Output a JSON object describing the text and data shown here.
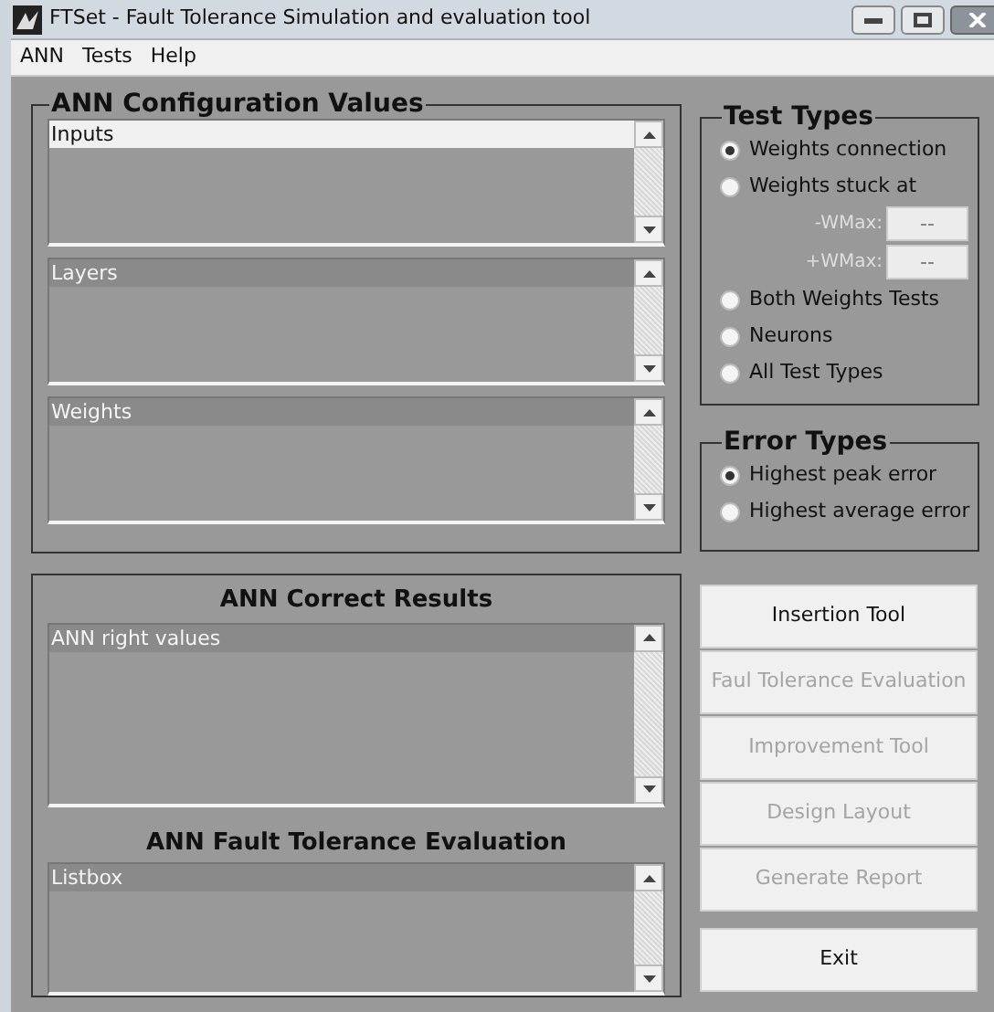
{
  "window": {
    "title": "FTSet - Fault Tolerance Simulation and evaluation tool"
  },
  "menu": [
    "ANN",
    "Tests",
    "Help"
  ],
  "config_panel": {
    "title": "ANN Configuration Values",
    "listboxes": [
      {
        "focused": true,
        "items": [
          {
            "label": "Inputs",
            "selected": true
          }
        ]
      },
      {
        "focused": false,
        "items": [
          {
            "label": "Layers",
            "selected": true
          }
        ]
      },
      {
        "focused": false,
        "items": [
          {
            "label": "Weights",
            "selected": true
          }
        ]
      }
    ]
  },
  "test_types": {
    "title": "Test Types",
    "options": [
      {
        "kind": "radio",
        "label": "Weights connection",
        "selected": true
      },
      {
        "kind": "radio",
        "label": "Weights stuck at",
        "selected": false,
        "fields": [
          {
            "label": "-WMax:",
            "value": "--",
            "disabled": true
          },
          {
            "label": "+WMax:",
            "value": "--",
            "disabled": true
          }
        ]
      },
      {
        "kind": "radio",
        "label": "Both Weights Tests",
        "selected": false
      },
      {
        "kind": "radio",
        "label": "Neurons",
        "selected": false
      },
      {
        "kind": "radio",
        "label": "All Test Types",
        "selected": false
      }
    ]
  },
  "error_types": {
    "title": "Error Types",
    "options": [
      {
        "label": "Highest peak error",
        "selected": true
      },
      {
        "label": "Highest average error",
        "selected": false
      }
    ]
  },
  "results_panel": [
    {
      "title": "ANN Correct Results",
      "listbox": {
        "focused": false,
        "items": [
          {
            "label": "ANN right values",
            "selected": true
          }
        ]
      }
    },
    {
      "title": "ANN Fault Tolerance Evaluation",
      "listbox": {
        "focused": false,
        "items": [
          {
            "label": "Listbox",
            "selected": true
          }
        ]
      }
    }
  ],
  "actions": [
    {
      "label": "Insertion Tool",
      "disabled": false
    },
    {
      "label": "Faul Tolerance Evaluation",
      "disabled": true
    },
    {
      "label": "Improvement Tool",
      "disabled": true
    },
    {
      "label": "Design Layout",
      "disabled": true
    },
    {
      "label": "Generate Report",
      "disabled": true
    }
  ],
  "exit_button": {
    "label": "Exit",
    "disabled": false
  }
}
